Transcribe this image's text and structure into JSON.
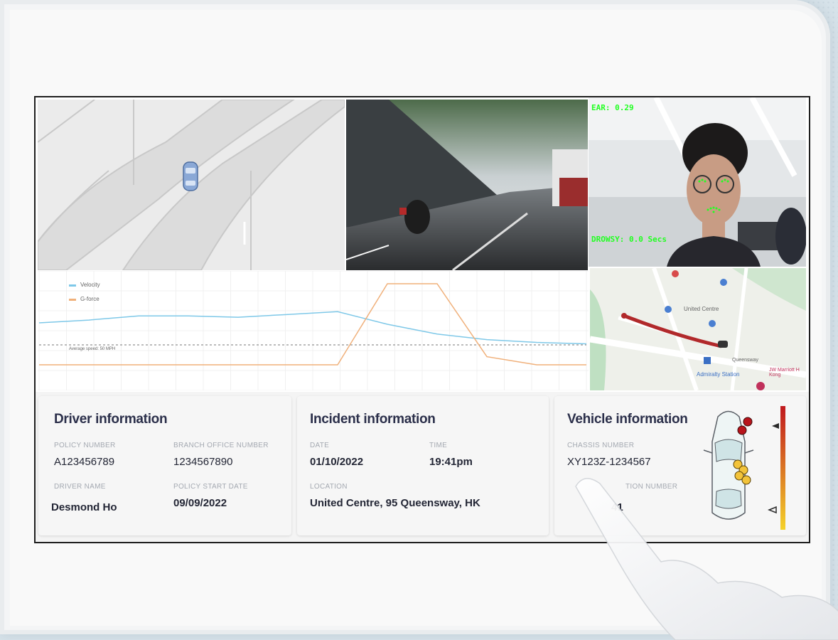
{
  "chart_data": {
    "type": "line",
    "series": [
      {
        "name": "Velocity",
        "color": "#7ec8e8",
        "values": [
          50,
          52,
          55,
          55,
          54,
          56,
          58,
          49,
          42,
          38,
          36,
          35
        ]
      },
      {
        "name": "G-force",
        "color": "#f0b07a",
        "values": [
          0,
          0,
          0,
          0,
          0,
          0,
          0,
          100,
          100,
          10,
          0,
          0
        ]
      }
    ],
    "annotation": "Average speed: 50 MPH"
  },
  "face_cam": {
    "ear_label": "EAR: 0.29",
    "drowsy_label": "DROWSY: 0.0 Secs"
  },
  "street_map": {
    "labels": [
      "United Centre",
      "Admiralty Station",
      "Queensway",
      "JW Marriott H Kong"
    ]
  },
  "driver_info": {
    "title": "Driver information",
    "policy_number_label": "POLICY NUMBER",
    "policy_number": "A123456789",
    "branch_office_label": "BRANCH OFFICE NUMBER",
    "branch_office": "1234567890",
    "driver_name_label": "DRIVER NAME",
    "driver_name": "Desmond Ho",
    "policy_start_label": "POLICY START DATE",
    "policy_start": "09/09/2022"
  },
  "incident_info": {
    "title": "Incident information",
    "date_label": "DATE",
    "date": "01/10/2022",
    "time_label": "TIME",
    "time": "19:41pm",
    "location_label": "LOCATION",
    "location": "United Centre, 95 Queensway, HK"
  },
  "vehicle_info": {
    "title": "Vehicle information",
    "chassis_label": "CHASSIS NUMBER",
    "chassis": "XY123Z-1234567",
    "registration_label": "TION NUMBER",
    "registration": "41"
  },
  "colors": {
    "accent_dark": "#2b2f4a",
    "route_red": "#b1292b",
    "impact_scale_top": "#c0181e",
    "impact_scale_bottom": "#f5d22a"
  }
}
